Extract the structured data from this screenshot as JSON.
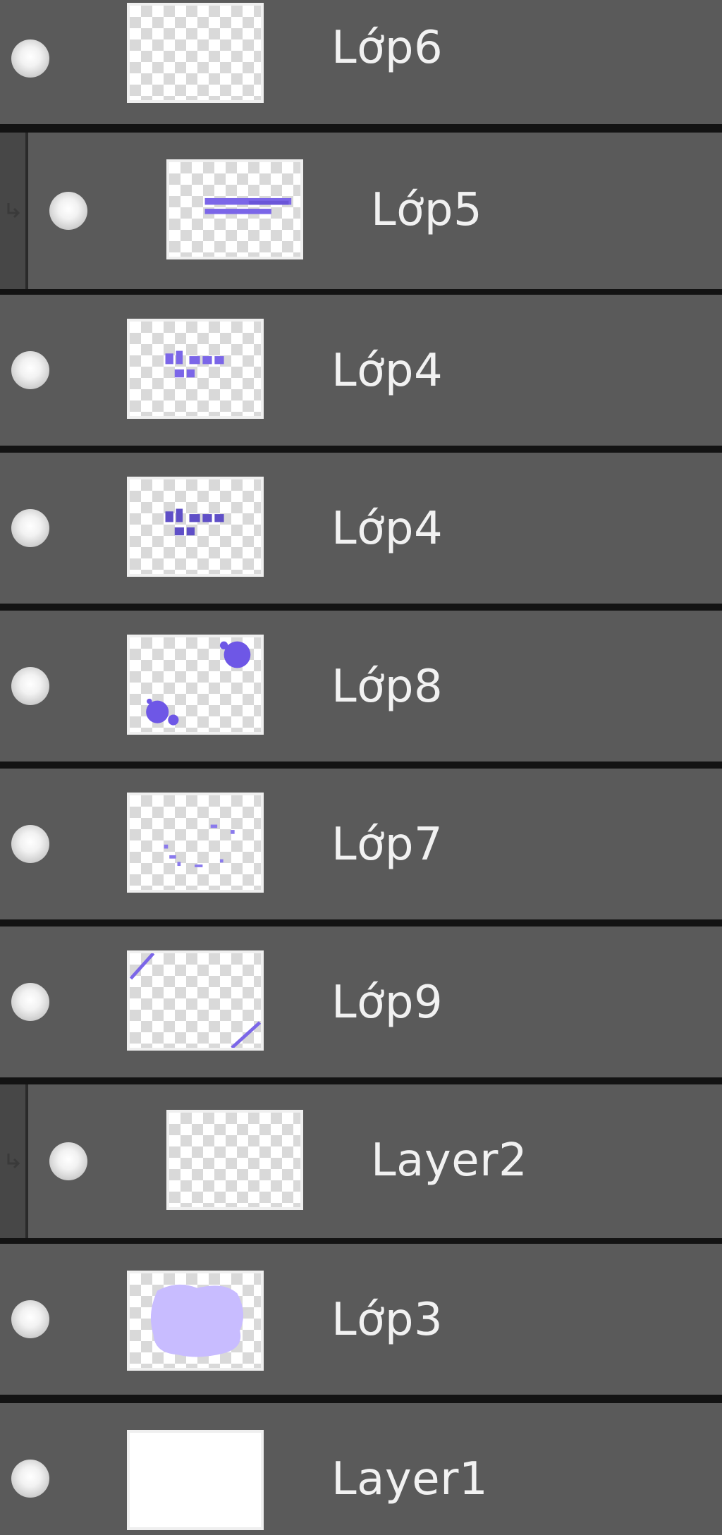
{
  "layers": [
    {
      "name": "Lớp6",
      "thumbnail": "empty-transparent-thumbnail",
      "clipped": false
    },
    {
      "name": "Lớp5",
      "thumbnail": "purple-stroke-thumbnail",
      "clipped": true
    },
    {
      "name": "Lớp4",
      "thumbnail": "purple-text-thumbnail",
      "clipped": false
    },
    {
      "name": "Lớp4",
      "thumbnail": "purple-text-thumbnail",
      "clipped": false
    },
    {
      "name": "Lớp8",
      "thumbnail": "purple-dots-thumbnail",
      "clipped": false
    },
    {
      "name": "Lớp7",
      "thumbnail": "purple-specks-thumbnail",
      "clipped": false
    },
    {
      "name": "Lớp9",
      "thumbnail": "purple-corner-lines-thumbnail",
      "clipped": false
    },
    {
      "name": "Layer2",
      "thumbnail": "empty-transparent-thumbnail",
      "clipped": true
    },
    {
      "name": "Lớp3",
      "thumbnail": "lavender-fill-thumbnail",
      "clipped": false
    },
    {
      "name": "Layer1",
      "thumbnail": "white-fill-thumbnail",
      "clipped": false
    }
  ],
  "colors": {
    "row_background": "#5a5a5a",
    "separator": "#131313",
    "accent_purple": "#7b66e8",
    "lavender": "#c8bcff",
    "text": "#f1f1f1"
  },
  "icons": {
    "visibility": "eye-dot-icon",
    "clipping": "clipping-arrow-icon"
  }
}
